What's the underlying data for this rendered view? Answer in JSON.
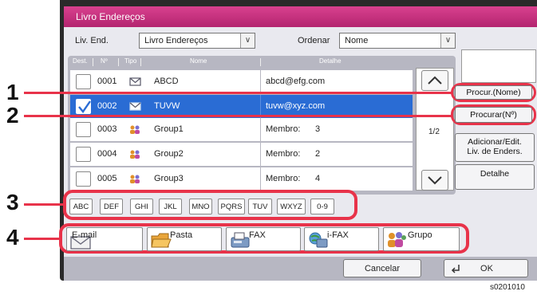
{
  "window": {
    "title": "Livro Endereços"
  },
  "filters": {
    "book_label": "Liv. End.",
    "book_value": "Livro Endereços",
    "sort_label": "Ordenar",
    "sort_value": "Nome"
  },
  "list": {
    "columns": [
      "Dest.",
      "Nº",
      "Tipo",
      "Nome",
      "Detalhe"
    ],
    "rows": [
      {
        "num": "0001",
        "type": "email-icon",
        "name": "ABCD",
        "detail": "abcd@efg.com",
        "detail_value": "",
        "selected": false
      },
      {
        "num": "0002",
        "type": "email-icon",
        "name": "TUVW",
        "detail": "tuvw@xyz.com",
        "detail_value": "",
        "selected": true
      },
      {
        "num": "0003",
        "type": "group-icon",
        "name": "Group1",
        "detail": "Membro:",
        "detail_value": "3",
        "selected": false
      },
      {
        "num": "0004",
        "type": "group-icon",
        "name": "Group2",
        "detail": "Membro:",
        "detail_value": "2",
        "selected": false
      },
      {
        "num": "0005",
        "type": "group-icon",
        "name": "Group3",
        "detail": "Membro:",
        "detail_value": "4",
        "selected": false
      }
    ],
    "page": "1/2"
  },
  "side_buttons": {
    "search_name": "Procur.(Nome)",
    "search_number": "Procurar(Nº)",
    "add_edit_line1": "Adicionar/Edit.",
    "add_edit_line2": "Liv. de Enders.",
    "detail": "Detalhe"
  },
  "letters": [
    "ABC",
    "DEF",
    "GHI",
    "JKL",
    "MNO",
    "PQRS",
    "TUV",
    "WXYZ",
    "0-9"
  ],
  "destinations": [
    {
      "label": "E-mail",
      "icon": "envelope-icon"
    },
    {
      "label": "Pasta",
      "icon": "folder-icon"
    },
    {
      "label": "FAX",
      "icon": "fax-icon"
    },
    {
      "label": "i-FAX",
      "icon": "ifax-icon"
    },
    {
      "label": "Grupo",
      "icon": "group-icon"
    }
  ],
  "bottom": {
    "cancel": "Cancelar",
    "ok": "OK"
  },
  "callouts": [
    "1",
    "2",
    "3",
    "4"
  ],
  "figure_code": "s0201010",
  "colors": {
    "title_bar": "#c8307f",
    "selection": "#2a6cd4",
    "callout": "#e8334a"
  }
}
